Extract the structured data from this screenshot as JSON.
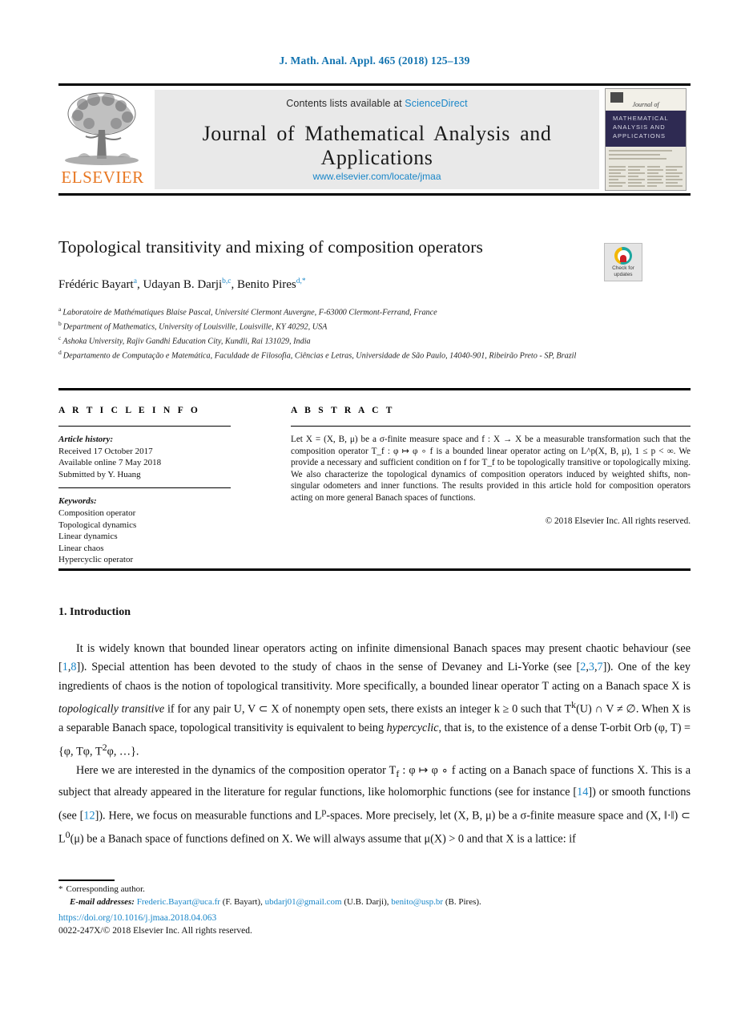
{
  "running_head": "J. Math. Anal. Appl. 465 (2018) 125–139",
  "header": {
    "contents_prefix": "Contents lists available at ",
    "sciencedirect": "ScienceDirect",
    "journal_title": "Journal of Mathematical Analysis and Applications",
    "journal_url": "www.elsevier.com/locate/jmaa",
    "publisher": "ELSEVIER",
    "cover": {
      "journal_of": "Journal of",
      "band_line1": "MATHEMATICAL",
      "band_line2": "ANALYSIS AND",
      "band_line3": "APPLICATIONS"
    }
  },
  "article": {
    "title": "Topological transitivity and mixing of composition operators",
    "crossmark_line1": "Check for",
    "crossmark_line2": "updates",
    "authors": [
      {
        "name": "Frédéric Bayart",
        "marks": "a"
      },
      {
        "name": "Udayan B. Darji",
        "marks": "b,c"
      },
      {
        "name": "Benito Pires",
        "marks": "d,*"
      }
    ],
    "affiliations": [
      {
        "label": "a",
        "text": "Laboratoire de Mathématiques Blaise Pascal, Université Clermont Auvergne, F-63000 Clermont-Ferrand, France"
      },
      {
        "label": "b",
        "text": "Department of Mathematics, University of Louisville, Louisville, KY 40292, USA"
      },
      {
        "label": "c",
        "text": "Ashoka University, Rajiv Gandhi Education City, Kundli, Rai 131029, India"
      },
      {
        "label": "d",
        "text": "Departamento de Computação e Matemática, Faculdade de Filosofia, Ciências e Letras, Universidade de São Paulo, 14040-901, Ribeirão Preto - SP, Brazil"
      }
    ]
  },
  "info": {
    "heading": "A R T I C L E    I N F O",
    "history_label": "Article history:",
    "history": [
      "Received 17 October 2017",
      "Available online 7 May 2018",
      "Submitted by Y. Huang"
    ],
    "keywords_label": "Keywords:",
    "keywords": [
      "Composition operator",
      "Topological dynamics",
      "Linear dynamics",
      "Linear chaos",
      "Hypercyclic operator"
    ]
  },
  "abstract": {
    "heading": "A B S T R A C T",
    "text": "Let X = (X, B, μ) be a σ-finite measure space and f : X → X be a measurable transformation such that the composition operator T_f : φ ↦ φ ∘ f is a bounded linear operator acting on L^p(X, B, μ), 1 ≤ p < ∞. We provide a necessary and sufficient condition on f for T_f to be topologically transitive or topologically mixing. We also characterize the topological dynamics of composition operators induced by weighted shifts, non-singular odometers and inner functions. The results provided in this article hold for composition operators acting on more general Banach spaces of functions.",
    "copyright": "© 2018 Elsevier Inc. All rights reserved."
  },
  "section": {
    "number_title": "1.  Introduction",
    "paragraph1_parts": [
      "It is widely known that bounded linear operators acting on infinite dimensional Banach spaces may present chaotic behaviour (see [",
      "1",
      ",",
      "8",
      "]). Special attention has been devoted to the study of chaos in the sense of Devaney and Li-Yorke (see [",
      "2",
      ",",
      "3",
      ",",
      "7",
      "]). One of the key ingredients of chaos is the notion of topological transitivity. More specifically, a bounded linear operator T acting on a Banach space X is ",
      "topologically transitive",
      " if for any pair U, V ⊂ X of nonempty open sets, there exists an integer k ≥ 0 such that T",
      "k",
      "(U) ∩ V ≠ ∅. When X is a separable Banach space, topological transitivity is equivalent to being ",
      "hypercyclic",
      ", that is, to the existence of a dense T-orbit Orb (φ, T) = {φ, Tφ, T",
      "2",
      "φ, …}."
    ],
    "paragraph2_parts": [
      "Here we are interested in the dynamics of the composition operator T",
      "f",
      " : φ ↦ φ ∘ f acting on a Banach space of functions X. This is a subject that already appeared in the literature for regular functions, like holomorphic functions (see for instance [",
      "14",
      "]) or smooth functions (see [",
      "12",
      "]). Here, we focus on measurable functions and L",
      "p",
      "-spaces. More precisely, let (X, B, μ) be a σ-finite measure space and (X, ‖·‖) ⊂ L",
      "0",
      "(μ) be a Banach space of functions defined on X. We will always assume that μ(X) > 0 and that X is a lattice: if"
    ]
  },
  "footer": {
    "corresponding_star": "*",
    "corresponding": "Corresponding author.",
    "email_label": "E-mail addresses:",
    "emails": [
      {
        "address": "Frederic.Bayart@uca.fr",
        "owner": "(F. Bayart)"
      },
      {
        "address": "ubdarj01@gmail.com",
        "owner": "(U.B. Darji)"
      },
      {
        "address": "benito@usp.br",
        "owner": "(B. Pires)"
      }
    ],
    "doi": "https://doi.org/10.1016/j.jmaa.2018.04.063",
    "issn_line": "0022-247X/© 2018 Elsevier Inc. All rights reserved."
  },
  "colors": {
    "link": "#1986c8",
    "elsevier_orange": "#E87722",
    "cover_band": "#2e2a52",
    "crossmark_red": "#cf2027"
  }
}
